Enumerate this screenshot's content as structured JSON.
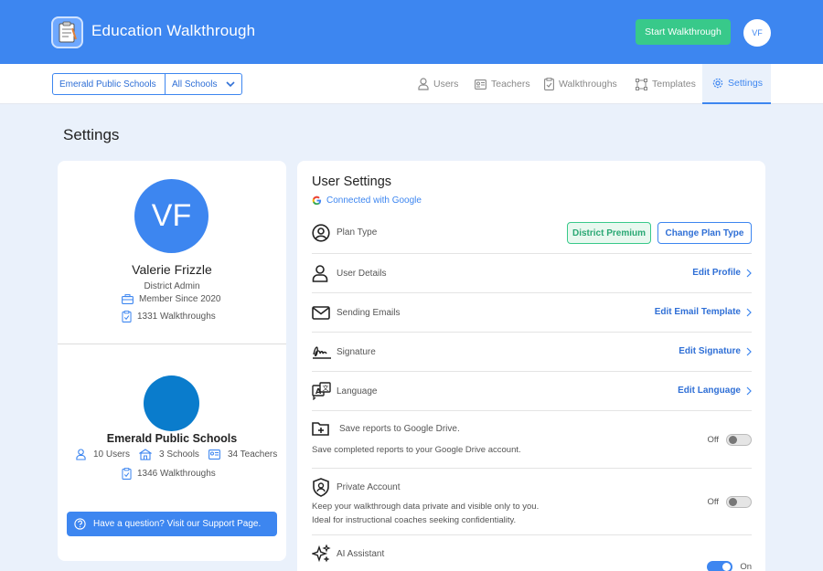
{
  "header": {
    "app_title": "Education Walkthrough",
    "start_button": "Start Walkthrough",
    "avatar_initials": "VF",
    "accent_color": "#3d86f0"
  },
  "nav": {
    "district": "Emerald Public Schools",
    "school_filter": "All Schools",
    "tabs": [
      {
        "label": "Users",
        "icon": "user-icon"
      },
      {
        "label": "Teachers",
        "icon": "id-card-icon"
      },
      {
        "label": "Walkthroughs",
        "icon": "clipboard-icon"
      },
      {
        "label": "Templates",
        "icon": "template-icon"
      },
      {
        "label": "Settings",
        "icon": "gear-icon",
        "active": true
      }
    ]
  },
  "page_title": "Settings",
  "profile": {
    "initials": "VF",
    "name": "Valerie Frizzle",
    "role": "District Admin",
    "member_since": "Member Since 2020",
    "walkthroughs": "1331 Walkthroughs"
  },
  "district_card": {
    "name": "Emerald Public Schools",
    "users": "10 Users",
    "schools": "3 Schools",
    "teachers": "34 Teachers",
    "walkthroughs": "1346 Walkthroughs",
    "support": "Have a question? Visit our Support Page."
  },
  "user_settings": {
    "title": "User Settings",
    "google": "Connected with Google",
    "plan_type": {
      "label": "Plan Type",
      "badge": "District Premium",
      "button": "Change Plan Type"
    },
    "user_details": {
      "label": "User Details",
      "action": "Edit Profile"
    },
    "sending_emails": {
      "label": "Sending Emails",
      "action": "Edit Email Template"
    },
    "signature": {
      "label": "Signature",
      "action": "Edit Signature"
    },
    "language": {
      "label": "Language",
      "action": "Edit Language"
    },
    "google_drive": {
      "label": "Save reports to Google Drive.",
      "desc": "Save completed reports to your Google Drive account.",
      "state": "Off"
    },
    "private_account": {
      "label": "Private Account",
      "desc1": "Keep your walkthrough data private and visible only to you.",
      "desc2": "Ideal for instructional coaches seeking confidentiality.",
      "state": "Off"
    },
    "ai_assistant": {
      "label": "AI Assistant",
      "state": "On"
    }
  }
}
